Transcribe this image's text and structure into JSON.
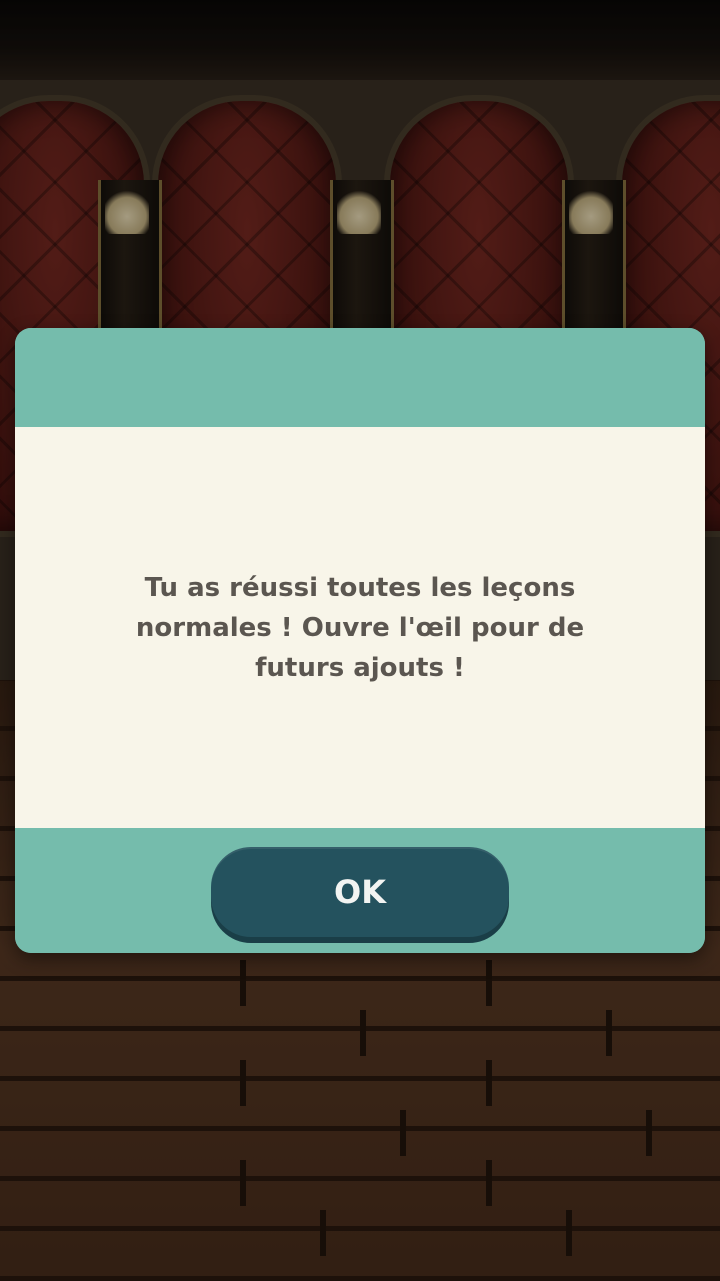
{
  "dialog": {
    "message": "Tu as réussi toutes les leçons normales ! Ouvre l'œil pour de futurs ajouts !",
    "ok_label": "OK"
  },
  "colors": {
    "dialog_teal": "#75bcac",
    "dialog_body": "#f8f5e9",
    "button_dark_teal": "#24525e",
    "message_text": "#5b5650"
  }
}
